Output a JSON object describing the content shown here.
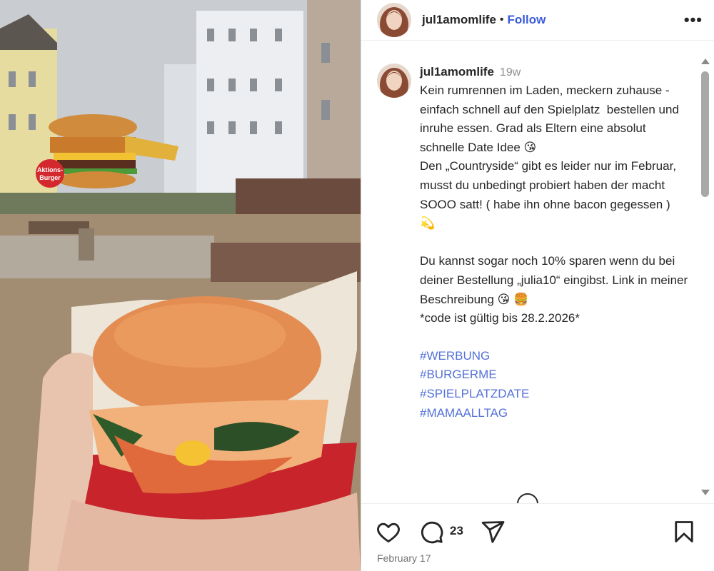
{
  "media": {
    "promo_badge": [
      "Aktions-",
      "Burger"
    ]
  },
  "post": {
    "username": "jul1amomlife",
    "follow_label": "Follow",
    "more_icon": "more-horizontal-icon",
    "caption": {
      "username": "jul1amomlife",
      "age": "19w",
      "text": "Kein rumrennen im Laden, meckern zuhause - einfach schnell auf den Spielplatz  bestellen und inruhe essen. Grad als Eltern eine absolut schnelle Date Idee 😘\nDen „Countryside“ gibt es leider nur im Februar, musst du unbedingt probiert haben der macht SOOO satt! ( habe ihn ohne bacon gegessen ) 💫\n\nDu kannst sogar noch 10% sparen wenn du bei deiner Bestellung „julia10“ eingibst. Link in meiner Beschreibung 😘 🍔\n*code ist gültig bis 28.2.2026*",
      "hashtags": [
        "#WERBUNG",
        "#BURGERME",
        "#SPIELPLATZDATE",
        "#MAMAALLTAG"
      ]
    },
    "comment_count": "23",
    "date": "February 17"
  },
  "colors": {
    "follow": "#3a5bd9",
    "hashtag": "#5471d8",
    "muted": "#737373"
  }
}
